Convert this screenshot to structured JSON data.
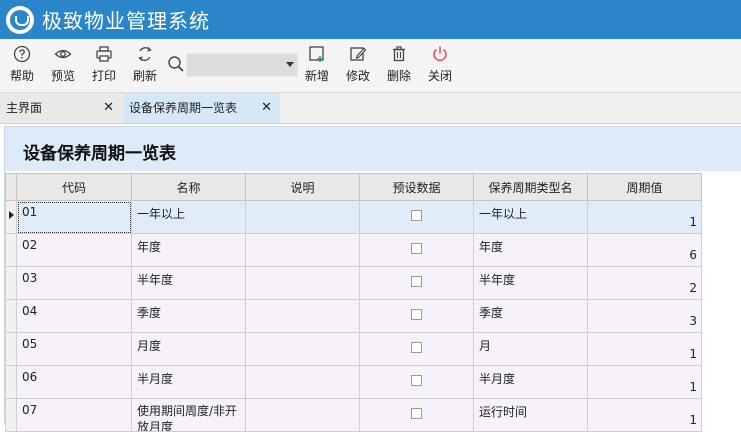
{
  "app": {
    "title": "极致物业管理系统"
  },
  "toolbar": {
    "help": "帮助",
    "preview": "预览",
    "print": "打印",
    "refresh": "刷新",
    "add": "新增",
    "edit": "修改",
    "delete": "删除",
    "close": "关闭",
    "search_value": ""
  },
  "tabs": [
    {
      "label": "主界面"
    },
    {
      "label": "设备保养周期一览表"
    }
  ],
  "panel": {
    "title": "设备保养周期一览表"
  },
  "table": {
    "columns": [
      "代码",
      "名称",
      "说明",
      "预设数据",
      "保养周期类型名",
      "周期值"
    ],
    "rows": [
      {
        "code": "01",
        "name": "一年以上",
        "desc": "",
        "type": "一年以上",
        "value": "1"
      },
      {
        "code": "02",
        "name": "年度",
        "desc": "",
        "type": "年度",
        "value": "6"
      },
      {
        "code": "03",
        "name": "半年度",
        "desc": "",
        "type": "半年度",
        "value": "2"
      },
      {
        "code": "04",
        "name": "季度",
        "desc": "",
        "type": "季度",
        "value": "3"
      },
      {
        "code": "05",
        "name": "月度",
        "desc": "",
        "type": "月",
        "value": "1"
      },
      {
        "code": "06",
        "name": "半月度",
        "desc": "",
        "type": "半月度",
        "value": "1"
      },
      {
        "code": "07",
        "name": "使用期间周度/非开放月度",
        "desc": "",
        "type": "运行时间",
        "value": "1"
      }
    ]
  },
  "colors": {
    "titlebar": "#2b86c9",
    "header": "#dcebf7",
    "selected": "#e0edf8",
    "close_icon": "#e05050",
    "add_icon": "#2e9e4e"
  }
}
